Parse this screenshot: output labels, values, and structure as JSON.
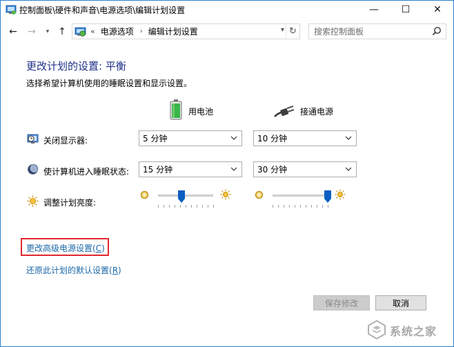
{
  "window": {
    "title": "控制面板\\硬件和声音\\电源选项\\编辑计划设置",
    "controls": {
      "minimize": "—",
      "maximize": "☐",
      "close": "✕"
    }
  },
  "nav": {
    "back": "←",
    "forward": "→",
    "recent": "▾",
    "up": "↑",
    "crumb_more": "«",
    "crumbs": [
      "电源选项",
      "编辑计划设置"
    ],
    "crumb_sep": "›",
    "dropdown": "▾",
    "refresh": "↻",
    "search_placeholder": "搜索控制面板"
  },
  "page": {
    "heading": "更改计划的设置: 平衡",
    "subheading": "选择希望计算机使用的睡眠设置和显示设置。"
  },
  "columns": {
    "battery": "用电池",
    "plugged_in": "接通电源"
  },
  "settings": [
    {
      "label": "关闭显示器:",
      "battery": "5 分钟",
      "plugged_in": "10 分钟",
      "icon": "monitor-clock-icon"
    },
    {
      "label": "使计算机进入睡眠状态:",
      "battery": "15 分钟",
      "plugged_in": "30 分钟",
      "icon": "moon-icon"
    }
  ],
  "brightness": {
    "label": "调整计划亮度:",
    "icon": "sun-icon",
    "battery_level": 0.42,
    "plugged_in_level": 1.0
  },
  "links": {
    "advanced": "更改高级电源设置(",
    "advanced_key": "C",
    "advanced_end": ")",
    "restore": "还原此计划的默认设置(",
    "restore_key": "R",
    "restore_end": ")"
  },
  "buttons": {
    "save": "保存修改",
    "cancel": "取消"
  },
  "watermark": {
    "text": "系统之家"
  },
  "colors": {
    "heading": "#1e3287",
    "link": "#1a67a6",
    "highlight": "#e0282e",
    "slider_thumb": "#0a5fc0"
  }
}
